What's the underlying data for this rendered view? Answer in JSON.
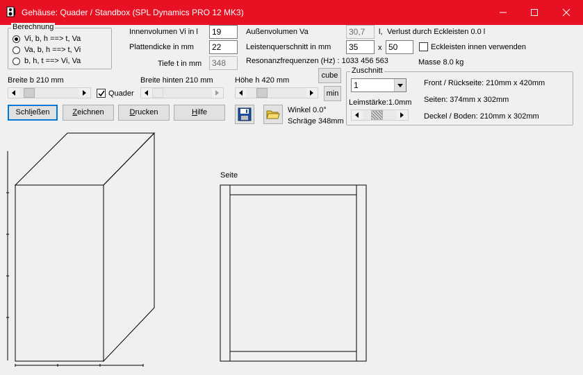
{
  "window": {
    "title": "Gehäuse: Quader / Standbox (SPL Dynamics PRO 12 MK3)",
    "controls": [
      "minimize-icon",
      "maximize-icon",
      "close-icon"
    ]
  },
  "calc_group": {
    "label": "Berechnung",
    "options": [
      {
        "label": "Vi, b, h ==>  t, Va",
        "checked": true
      },
      {
        "label": "Va, b, h ==> t, Vi",
        "checked": false
      },
      {
        "label": "b, h, t ==> Vi, Va",
        "checked": false
      }
    ]
  },
  "fields": {
    "innenvolumen_label": "Innenvolumen Vi in l",
    "innenvolumen_value": "19",
    "plattendicke_label": "Plattendicke in mm",
    "plattendicke_value": "22",
    "tiefe_label": "Tiefe t in mm",
    "tiefe_value": "348",
    "aussenvolumen_label": "Außenvolumen Va",
    "aussenvolumen_value": "30,7",
    "aussenvolumen_unit": "l,",
    "verlust_text": "Verlust durch Eckleisten 0.0 l",
    "leisten_label": "Leistenquerschnitt in mm",
    "leisten_a": "35",
    "leisten_x": "x",
    "leisten_b": "50",
    "eckleisten_label": "Eckleisten innen verwenden",
    "eckleisten_checked": false,
    "resonanz_text": "Resonanzfrequenzen (Hz) : 1033  456  563",
    "masse_text": "Masse 8.0 kg"
  },
  "sliders": {
    "breite_label": "Breite b 210 mm",
    "breite_value": 0.12,
    "quader_label": "Quader",
    "quader_checked": true,
    "breite_hinten_label": "Breite hinten 210 mm",
    "breite_hinten_value": 0.0,
    "hoehe_label": "Höhe h 420 mm",
    "hoehe_value": 0.05
  },
  "buttons": {
    "cube": "cube",
    "min": "min",
    "schliessen": {
      "pre": "Schl",
      "ul": "i",
      "post": "eßen"
    },
    "zeichnen": {
      "pre": "",
      "ul": "Z",
      "post": "eichnen"
    },
    "drucken": {
      "pre": "",
      "ul": "D",
      "post": "rucken"
    },
    "hilfe": {
      "pre": "",
      "ul": "H",
      "post": "ilfe"
    }
  },
  "angles": {
    "winkel": "Winkel 0.0°",
    "schraege": "Schräge 348mm"
  },
  "zuschnitt": {
    "label": "Zuschnitt",
    "count_value": "1",
    "leimstaerke_label": "Leimstärke:1.0mm",
    "leim_value": 0.45,
    "front_text": "Front / Rückseite: 210mm x 420mm",
    "seiten_text": "Seiten: 374mm x 302mm",
    "deckel_text": "Deckel / Boden: 210mm x 302mm"
  },
  "drawing": {
    "seite_label": "Seite",
    "box": {
      "breite_mm": 210,
      "hoehe_mm": 420,
      "tiefe_mm": 348,
      "plattendicke_mm": 22
    }
  }
}
